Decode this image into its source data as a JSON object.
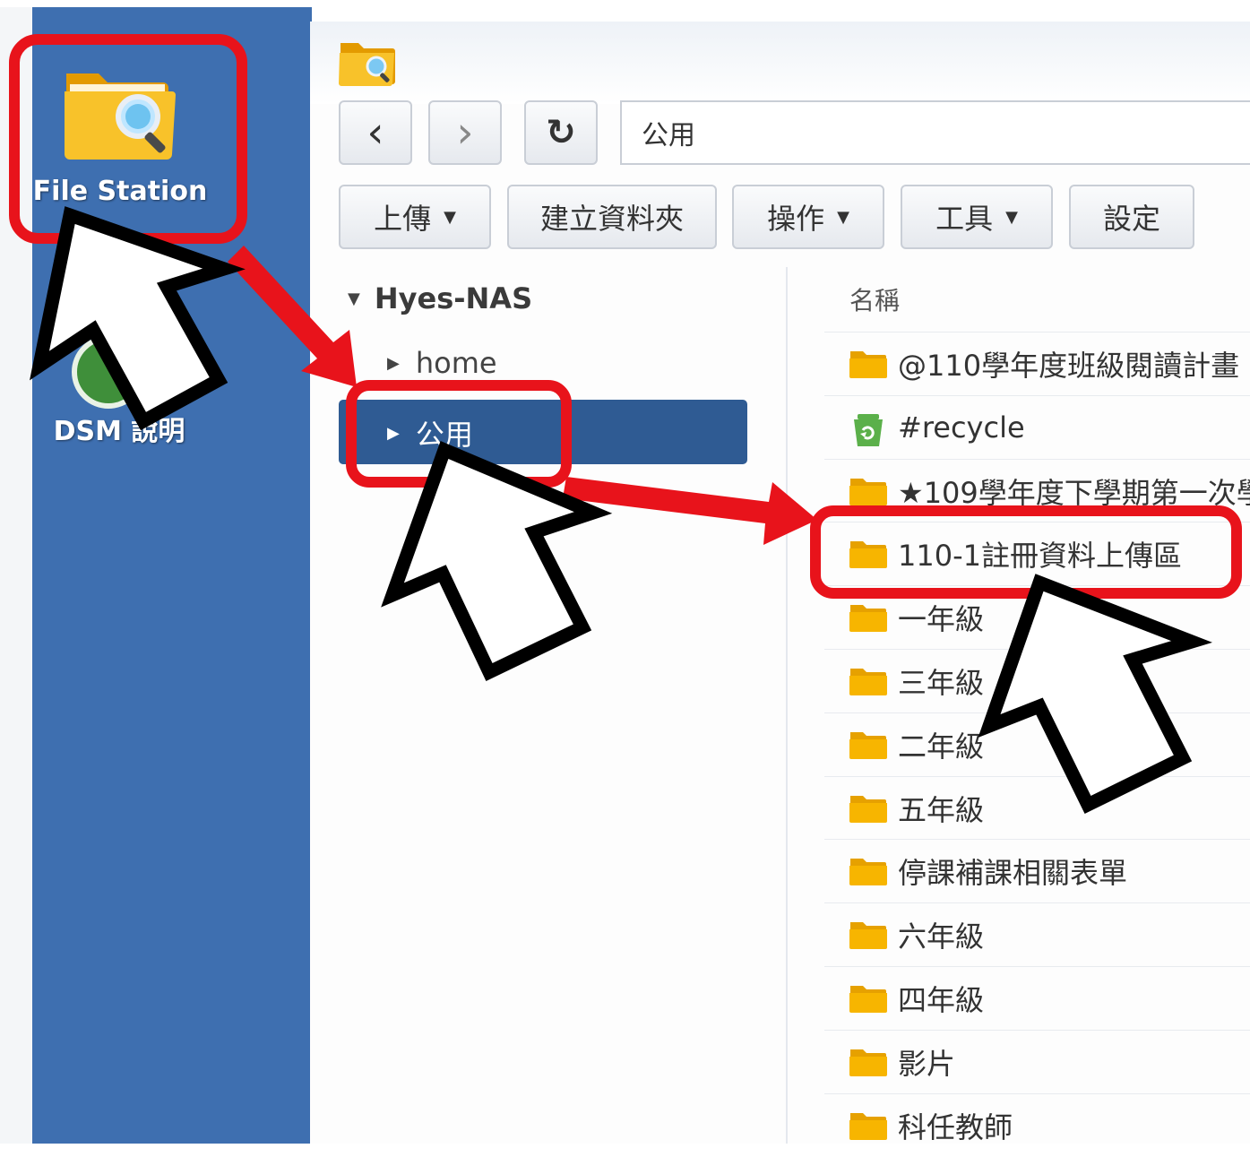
{
  "desktop": {
    "file_station_label": "File Station",
    "dsm_label": "DSM 說明"
  },
  "toolbar": {
    "back_glyph": "‹",
    "forward_glyph": "›",
    "refresh_glyph": "↻",
    "path": "公用",
    "upload_label": "上傳",
    "create_folder_label": "建立資料夾",
    "action_label": "操作",
    "tools_label": "工具",
    "settings_label": "設定"
  },
  "tree": {
    "root": "Hyes-NAS",
    "items": [
      {
        "label": "home"
      },
      {
        "label": "公用"
      }
    ]
  },
  "list": {
    "header": "名稱",
    "rows": [
      {
        "name": "@110學年度班級閱讀計畫",
        "icon": "folder-icon"
      },
      {
        "name": "#recycle",
        "icon": "recycle-bin-icon"
      },
      {
        "name": "★109學年度下學期第一次學",
        "icon": "folder-icon"
      },
      {
        "name": "110-1註冊資料上傳區",
        "icon": "folder-icon"
      },
      {
        "name": "一年級",
        "icon": "folder-icon"
      },
      {
        "name": "三年級",
        "icon": "folder-icon"
      },
      {
        "name": "二年級",
        "icon": "folder-icon"
      },
      {
        "name": "五年級",
        "icon": "folder-icon"
      },
      {
        "name": "停課補課相關表單",
        "icon": "folder-icon"
      },
      {
        "name": "六年級",
        "icon": "folder-icon"
      },
      {
        "name": "四年級",
        "icon": "folder-icon"
      },
      {
        "name": "影片",
        "icon": "folder-icon"
      },
      {
        "name": "科任教師",
        "icon": "folder-icon"
      }
    ]
  },
  "colors": {
    "desktop_blue": "#3e6fb0",
    "selected_blue": "#2f5b93",
    "highlight_red": "#e8131b",
    "folder_yellow": "#f7b500"
  }
}
